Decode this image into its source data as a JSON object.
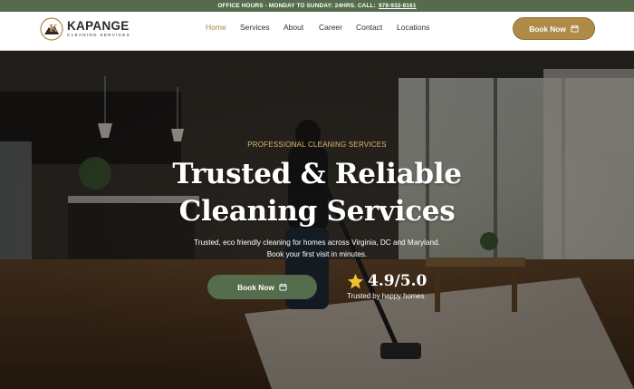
{
  "topbar": {
    "hours_text": "OFFICE HOURS - MONDAY TO SUNDAY: 24HRS. CALL:",
    "phone": "978-932-8161"
  },
  "brand": {
    "name": "KAPANGE",
    "tagline": "CLEANING SERVICES",
    "accent": "#b08a47",
    "green": "#566d4d"
  },
  "nav": {
    "items": [
      {
        "label": "Home",
        "active": true
      },
      {
        "label": "Services"
      },
      {
        "label": "About"
      },
      {
        "label": "Career"
      },
      {
        "label": "Contact"
      },
      {
        "label": "Locations"
      }
    ]
  },
  "header": {
    "book_label": "Book Now",
    "book_icon": "calendar-icon"
  },
  "hero": {
    "eyebrow": "PROFESSIONAL CLEANING SERVICES",
    "headline_line1": "Trusted & Reliable",
    "headline_line2": "Cleaning Services",
    "sub_line1": "Trusted, eco friendly cleaning for homes across Virginia, DC and Maryland.",
    "sub_line2": "Book your first visit in minutes.",
    "book_label": "Book Now",
    "book_icon": "calendar-icon",
    "rating_icon": "star-icon",
    "rating_value": "4.9/5.0",
    "rating_caption": "Trusted by happy homes"
  }
}
